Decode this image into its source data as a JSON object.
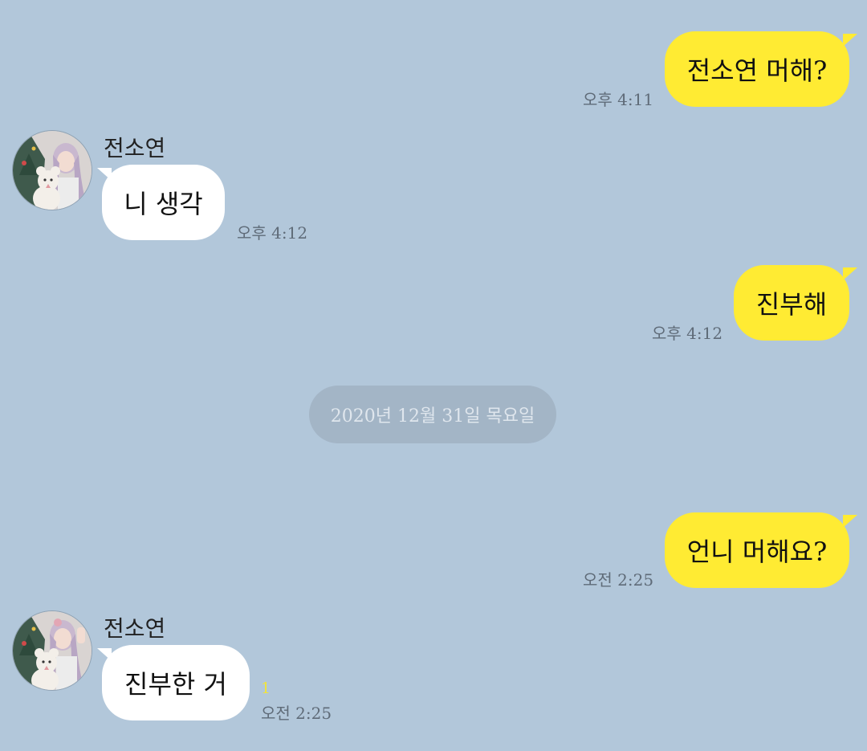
{
  "chat": {
    "messages": [
      {
        "type": "sent",
        "text": "전소연 머해?",
        "time": "오후 4:11"
      },
      {
        "type": "received",
        "sender": "전소연",
        "text": "니 생각",
        "time": "오후 4:12"
      },
      {
        "type": "sent",
        "text": "진부해",
        "time": "오후 4:12"
      },
      {
        "type": "date",
        "text": "2020년 12월 31일 목요일"
      },
      {
        "type": "sent",
        "text": "언니 머해요?",
        "time": "오전 2:25"
      },
      {
        "type": "received",
        "sender": "전소연",
        "text": "진부한 거",
        "time": "오전 2:25",
        "unread": "1"
      }
    ]
  },
  "colors": {
    "background": "#b2c7da",
    "sent_bubble": "#ffeb33",
    "received_bubble": "#ffffff",
    "unread_count": "#f2e43a"
  }
}
